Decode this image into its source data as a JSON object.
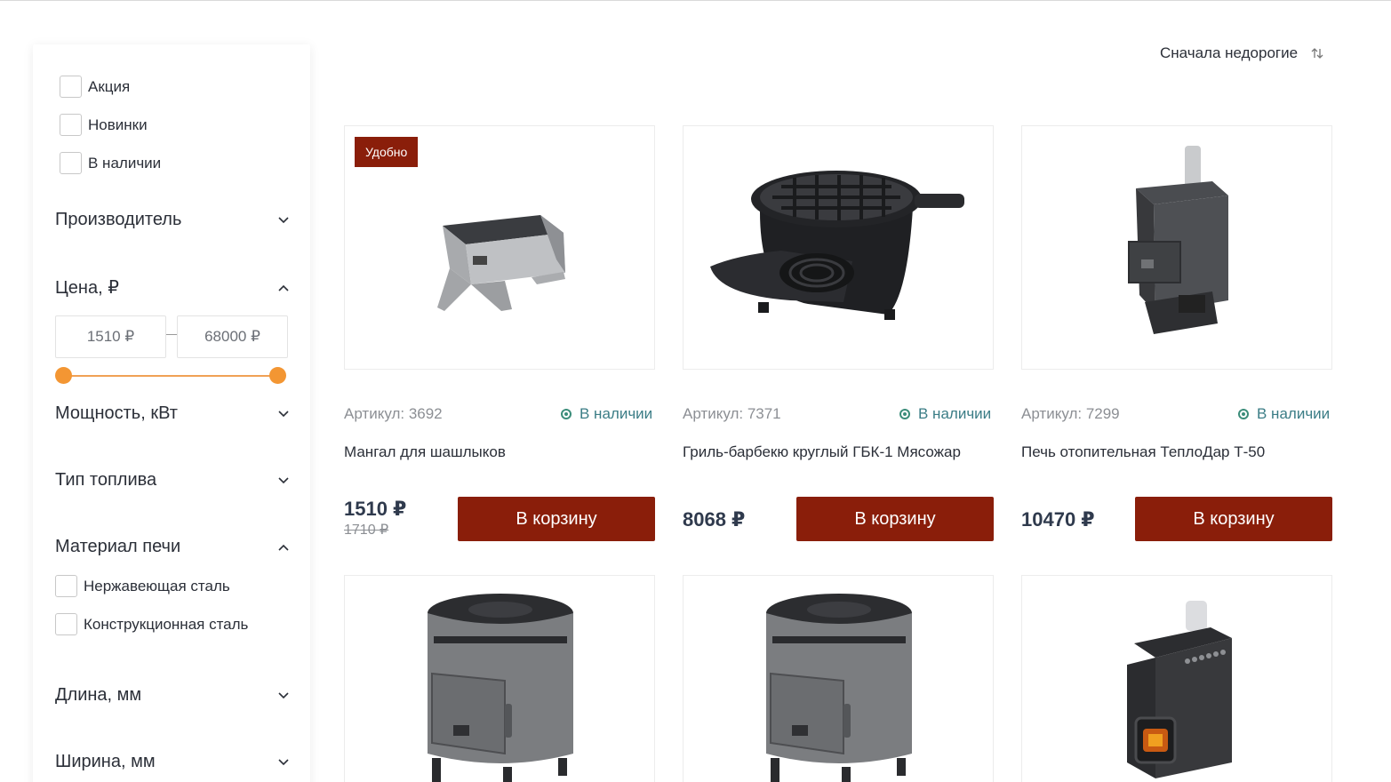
{
  "sort": {
    "label": "Сначала недорогие",
    "icon": "sort-arrows-icon"
  },
  "filters": {
    "checks": [
      {
        "label": "Акция",
        "checked": false
      },
      {
        "label": "Новинки",
        "checked": false
      },
      {
        "label": "В наличии",
        "checked": false
      }
    ],
    "manufacturer": {
      "title": "Производитель",
      "expanded": false
    },
    "price": {
      "title": "Цена, ₽",
      "expanded": true,
      "min": "1510 ₽",
      "max": "68000 ₽",
      "range_low_fraction": 0,
      "range_high_fraction": 1
    },
    "power": {
      "title": "Мощность, кВт",
      "expanded": false
    },
    "fuel": {
      "title": "Тип топлива",
      "expanded": false
    },
    "material": {
      "title": "Материал печи",
      "expanded": true,
      "options": [
        {
          "label": "Нержавеющая сталь",
          "checked": false
        },
        {
          "label": "Конструкционная сталь",
          "checked": false
        }
      ]
    },
    "length": {
      "title": "Длина, мм",
      "expanded": false
    },
    "width": {
      "title": "Ширина, мм",
      "expanded": false
    }
  },
  "products": [
    {
      "badge": "Удобно",
      "article": "Артикул: 3692",
      "stock": "В наличии",
      "name": "Мангал для шашлыков",
      "price": "1510 ₽",
      "old_price": "1710 ₽",
      "button": "В корзину",
      "image": "brazier-image"
    },
    {
      "badge": "",
      "article": "Артикул: 7371",
      "stock": "В наличии",
      "name": "Гриль-барбекю круглый ГБК-1 Мясожар",
      "price": "8068 ₽",
      "old_price": "",
      "button": "В корзину",
      "image": "round-grill-image"
    },
    {
      "badge": "",
      "article": "Артикул: 7299",
      "stock": "В наличии",
      "name": "Печь отопительная ТеплоДар Т-50",
      "price": "10470 ₽",
      "old_price": "",
      "button": "В корзину",
      "image": "heating-stove-image"
    }
  ],
  "colors": {
    "accent": "#8a1e0a",
    "slider": "#f39633",
    "in_stock": "#3b7d86"
  }
}
